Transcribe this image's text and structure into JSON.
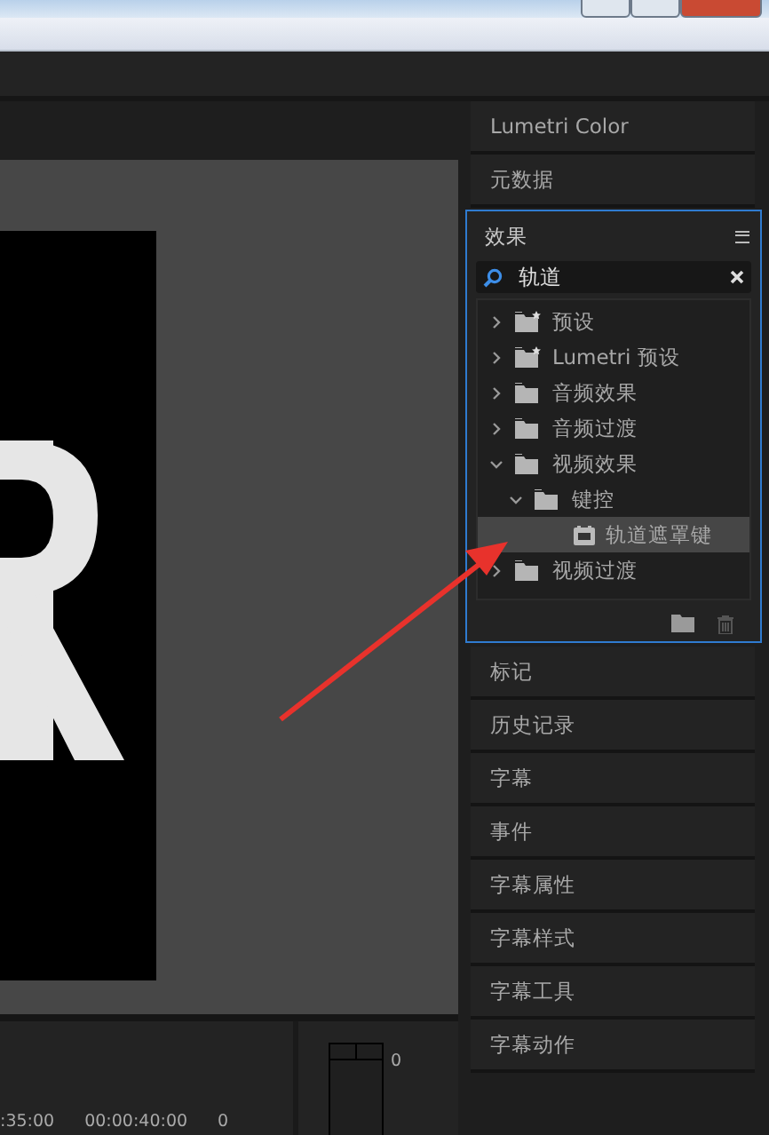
{
  "panels_top": [
    {
      "label": "Lumetri Color"
    },
    {
      "label": "元数据"
    }
  ],
  "effects_panel": {
    "title": "效果",
    "search": {
      "value": "轨道"
    },
    "tree": [
      {
        "kind": "preset-folder",
        "label": "预设",
        "expanded": false,
        "selected": false
      },
      {
        "kind": "preset-folder",
        "label": "Lumetri 预设",
        "expanded": false,
        "selected": false
      },
      {
        "kind": "folder",
        "label": "音频效果",
        "expanded": false,
        "selected": false
      },
      {
        "kind": "folder",
        "label": "音频过渡",
        "expanded": false,
        "selected": false
      },
      {
        "kind": "folder",
        "label": "视频效果",
        "expanded": true,
        "selected": false,
        "children": [
          {
            "kind": "folder",
            "label": "键控",
            "expanded": true,
            "selected": false,
            "children": [
              {
                "kind": "effect",
                "label": "轨道遮罩键",
                "selected": true
              }
            ]
          }
        ]
      },
      {
        "kind": "folder",
        "label": "视频过渡",
        "expanded": false,
        "selected": false
      }
    ]
  },
  "panels_bottom": [
    {
      "label": "标记"
    },
    {
      "label": "历史记录"
    },
    {
      "label": "字幕"
    },
    {
      "label": "事件"
    },
    {
      "label": "字幕属性"
    },
    {
      "label": "字幕样式"
    },
    {
      "label": "字幕工具"
    },
    {
      "label": "字幕动作"
    }
  ],
  "timeline": {
    "timecodes": [
      ":35:00",
      "00:00:40:00",
      "0"
    ]
  },
  "audio_meter": {
    "scale": [
      "0"
    ]
  }
}
